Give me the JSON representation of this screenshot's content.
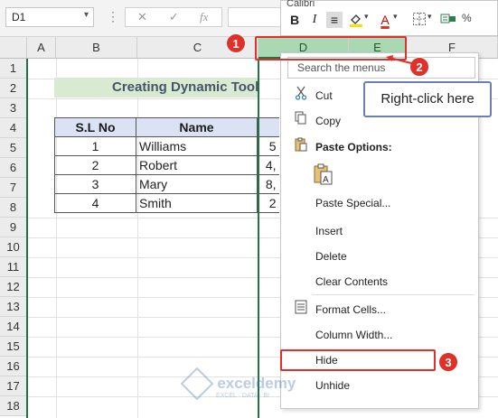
{
  "formula_bar": {
    "name_box": "D1",
    "cancel_glyph": "✕",
    "enter_glyph": "✓",
    "fx_label": "fx"
  },
  "columns": [
    "A",
    "B",
    "C",
    "D",
    "E",
    "F"
  ],
  "rows": [
    "1",
    "2",
    "3",
    "4",
    "5",
    "6",
    "7",
    "8",
    "9",
    "10",
    "11",
    "12",
    "13",
    "14",
    "15",
    "16",
    "17",
    "18"
  ],
  "sheet": {
    "title": "Creating Dynamic Toolti",
    "table_headers": [
      "S.L No",
      "Name"
    ],
    "table_rows": [
      {
        "sl": "1",
        "name": "Williams",
        "d": "5"
      },
      {
        "sl": "2",
        "name": "Robert",
        "d": "4,"
      },
      {
        "sl": "3",
        "name": "Mary",
        "d": "8,"
      },
      {
        "sl": "4",
        "name": "Smith",
        "d": "2"
      }
    ]
  },
  "mini_toolbar": {
    "font": "Calibri",
    "bold": "B",
    "italic": "I",
    "font_color_letter": "A",
    "more_glyph": "≡"
  },
  "context_menu": {
    "search_placeholder": "Search the menus",
    "cut": "Cut",
    "copy": "Copy",
    "paste_options": "Paste Options:",
    "paste_special": "Paste Special...",
    "insert": "Insert",
    "delete": "Delete",
    "clear_contents": "Clear Contents",
    "format_cells": "Format Cells...",
    "column_width": "Column Width...",
    "hide": "Hide",
    "unhide": "Unhide"
  },
  "annotations": {
    "step1": "1",
    "step2": "2",
    "step3": "3",
    "callout_text": "Right-click here"
  },
  "watermark": {
    "brand": "exceldemy",
    "tagline": "EXCEL · DATA · BI"
  },
  "colors": {
    "excel_green": "#217346",
    "selected_header": "#a9d8b3",
    "title_fill": "#d9ead3",
    "table_header_fill": "#dbe2f3",
    "annotation_red": "#e0302a",
    "callout_border": "#6b7fb3"
  }
}
